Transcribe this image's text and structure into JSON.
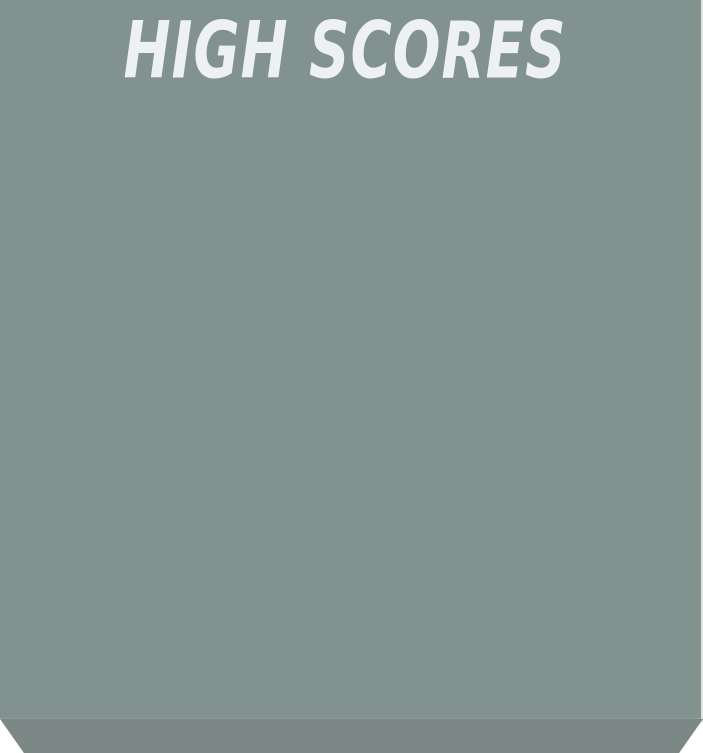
{
  "screen": {
    "title": "HIGH SCORES",
    "scores": []
  },
  "colors": {
    "panel": "#82938f",
    "panel_base": "#7b8885",
    "panel_edge": "#dfe4e3",
    "title_text": "#eef1f2"
  }
}
